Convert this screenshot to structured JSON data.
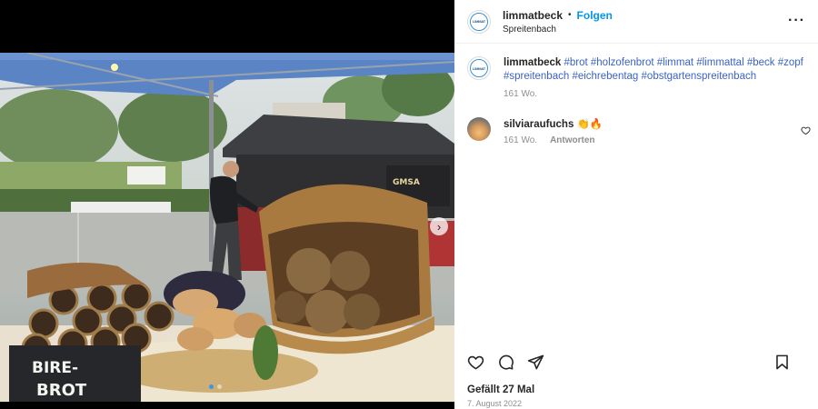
{
  "post": {
    "username": "limmatbeck",
    "separator": "•",
    "follow_label": "Folgen",
    "location": "Spreitenbach",
    "more_icon": "more-horizontal-icon",
    "logo_text": "LIMMAT"
  },
  "photo": {
    "sign_text_line1": "BIRE-",
    "sign_text_line2": "BROT",
    "oven_brand": "GMSA",
    "carousel_next_glyph": "›",
    "carousel_dots": 2,
    "active_dot": 0
  },
  "caption": {
    "username": "limmatbeck",
    "tags": "#brot #holzofenbrot #limmat #limmattal #beck #zopf #spreitenbach #eichrebentag #obstgartenspreitenbach",
    "time": "161 Wo."
  },
  "comment": {
    "username": "silviaraufuchs",
    "text": "👏🔥",
    "time": "161 Wo.",
    "reply_label": "Antworten"
  },
  "stats": {
    "likes": "Gefällt 27 Mal",
    "date": "7. August 2022"
  },
  "colors": {
    "accent": "#0095f6",
    "hashtag": "#3a62c8",
    "muted": "#8e8e8e"
  }
}
